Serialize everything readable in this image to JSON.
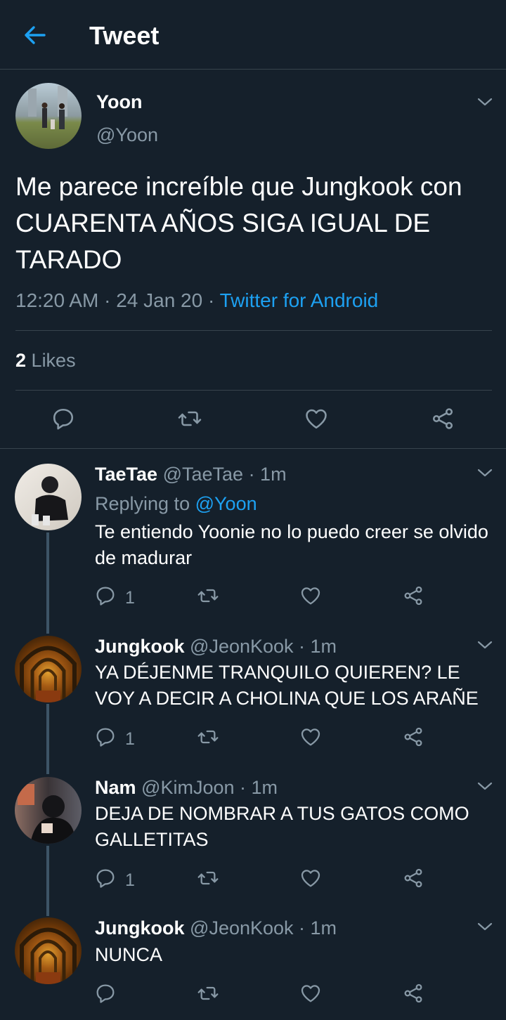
{
  "header": {
    "title": "Tweet",
    "back_icon": "arrow-left-icon"
  },
  "colors": {
    "background": "#15202b",
    "accent": "#1da1f2",
    "muted": "#8899a6",
    "divider": "#38444d"
  },
  "tweet": {
    "name": "Yoon",
    "handle": "@Yoon",
    "text": "Me parece increíble que Jungkook con CUARENTA AÑOS SIGA IGUAL DE TARADO",
    "time": "12:20 AM",
    "sep1": "·",
    "date": "24 Jan 20",
    "sep2": "·",
    "source": "Twitter for Android",
    "likes_count": "2",
    "likes_label": "Likes"
  },
  "replies": [
    {
      "name": "TaeTae",
      "handle": "@TaeTae",
      "time": "· 1m",
      "replying_label": "Replying to",
      "replying_to": "@Yoon",
      "text": "Te entiendo Yoonie no lo puedo creer se olvido de madurar",
      "reply_count": "1"
    },
    {
      "name": "Jungkook",
      "handle": "@JeonKook",
      "time": "· 1m",
      "text": "YA DÉJENME TRANQUILO QUIEREN? LE VOY A DECIR A CHOLINA QUE LOS ARAÑE",
      "reply_count": "1"
    },
    {
      "name": "Nam",
      "handle": "@KimJoon",
      "time": "· 1m",
      "text": "DEJA DE NOMBRAR A TUS GATOS COMO GALLETITAS",
      "reply_count": "1"
    },
    {
      "name": "Jungkook",
      "handle": "@JeonKook",
      "time": "· 1m",
      "text": "NUNCA",
      "reply_count": ""
    }
  ]
}
